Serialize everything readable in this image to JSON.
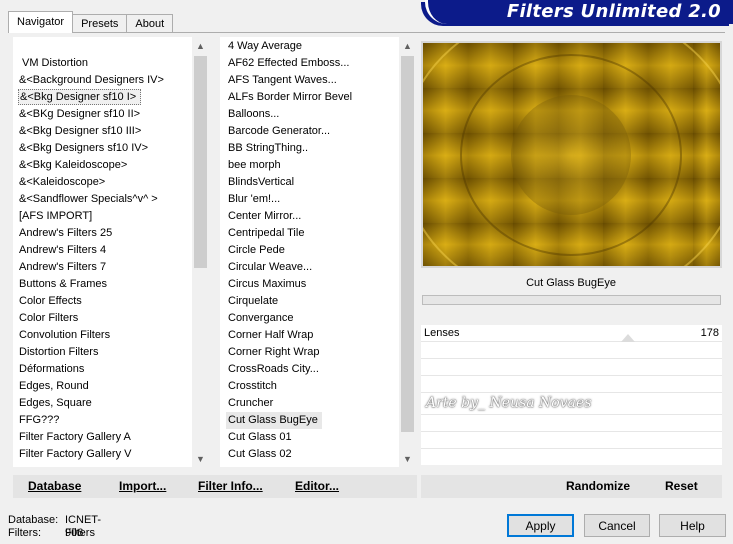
{
  "tabs": [
    {
      "label": "Navigator"
    },
    {
      "label": "Presets"
    },
    {
      "label": "About"
    }
  ],
  "banner": {
    "title": "Filters Unlimited 2.0"
  },
  "categories": [
    "VM Distortion",
    "&<Background Designers IV>",
    "&<Bkg Designer sf10 I>",
    "&<BKg Designer sf10 II>",
    "&<Bkg Designer sf10 III>",
    "&<Bkg Designers sf10 IV>",
    "&<Bkg Kaleidoscope>",
    "&<Kaleidoscope>",
    "&<Sandflower Specials^v^ >",
    "[AFS IMPORT]",
    "Andrew's Filters 25",
    "Andrew's Filters 4",
    "Andrew's Filters 7",
    "Buttons & Frames",
    "Color Effects",
    "Color Filters",
    "Convolution Filters",
    "Distortion Filters",
    "Déformations",
    "Edges, Round",
    "Edges, Square",
    "FFG???",
    "Filter Factory Gallery A",
    "Filter Factory Gallery V"
  ],
  "filters": [
    "4 Way Average",
    "AF62 Effected Emboss...",
    "AFS Tangent Waves...",
    "ALFs Border Mirror Bevel",
    "Balloons...",
    "Barcode Generator...",
    "BB StringThing..",
    "bee morph",
    "BlindsVertical",
    "Blur 'em!...",
    "Center Mirror...",
    "Centripedal Tile",
    "Circle Pede",
    "Circular Weave...",
    "Circus Maximus",
    "Cirquelate",
    "Convergance",
    "Corner Half Wrap",
    "Corner Right Wrap",
    "CrossRoads City...",
    "Crosstitch",
    "Cruncher",
    "Cut Glass  BugEye",
    "Cut Glass 01",
    "Cut Glass 02"
  ],
  "preview": {
    "filter_name": "Cut Glass  BugEye",
    "watermark": "Arte by_ Neusa Novaes"
  },
  "params": [
    {
      "label": "Lenses",
      "value": "178",
      "slider_fraction": 0.7
    }
  ],
  "left_buttons": {
    "database": "Database",
    "import": "Import...",
    "filter_info": "Filter Info...",
    "editor": "Editor..."
  },
  "right_buttons": {
    "randomize": "Randomize",
    "reset": "Reset"
  },
  "status": {
    "database_label": "Database:",
    "database_value": "ICNET-Filters",
    "filters_label": "Filters:",
    "filters_value": "906"
  },
  "dialog_buttons": {
    "apply": "Apply",
    "cancel": "Cancel",
    "help": "Help"
  },
  "colors": {
    "banner": "#0c1b8a",
    "preview_gold": "#b8900a",
    "default_button_border": "#0078d7"
  }
}
